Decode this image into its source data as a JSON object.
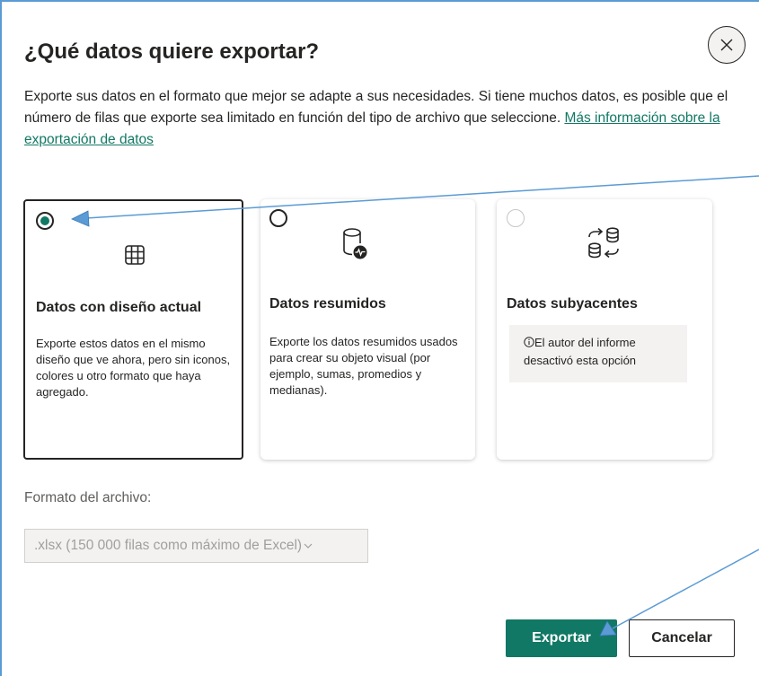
{
  "dialog": {
    "title": "¿Qué datos quiere exportar?",
    "description": "Exporte sus datos en el formato que mejor se adapte a sus necesidades. Si tiene muchos datos, es posible que el número de filas que exporte sea limitado en función del tipo de archivo que seleccione. ",
    "learn_more_link": "Más información sobre la exportación de datos",
    "close_icon": "close-icon"
  },
  "options": [
    {
      "title": "Datos con diseño actual",
      "description": "Exporte estos datos en el mismo diseño que ve ahora, pero sin iconos, colores u otro formato que haya agregado.",
      "icon": "table-icon",
      "state": "selected"
    },
    {
      "title": "Datos resumidos",
      "description": "Exporte los datos resumidos usados para crear su objeto visual (por ejemplo, sumas, promedios y medianas).",
      "icon": "database-chart-icon",
      "state": "unselected"
    },
    {
      "title": "Datos subyacentes",
      "note": "El autor del informe desactivó esta opción",
      "note_icon": "info-icon",
      "icon": "database-swap-icon",
      "state": "disabled"
    }
  ],
  "file_format": {
    "label": "Formato del archivo:",
    "selected": ".xlsx (150 000 filas como máximo de Excel)"
  },
  "buttons": {
    "export": "Exportar",
    "cancel": "Cancelar"
  },
  "colors": {
    "accent": "#117865",
    "annotation_arrow": "#5b9bd5",
    "text": "#252423"
  }
}
